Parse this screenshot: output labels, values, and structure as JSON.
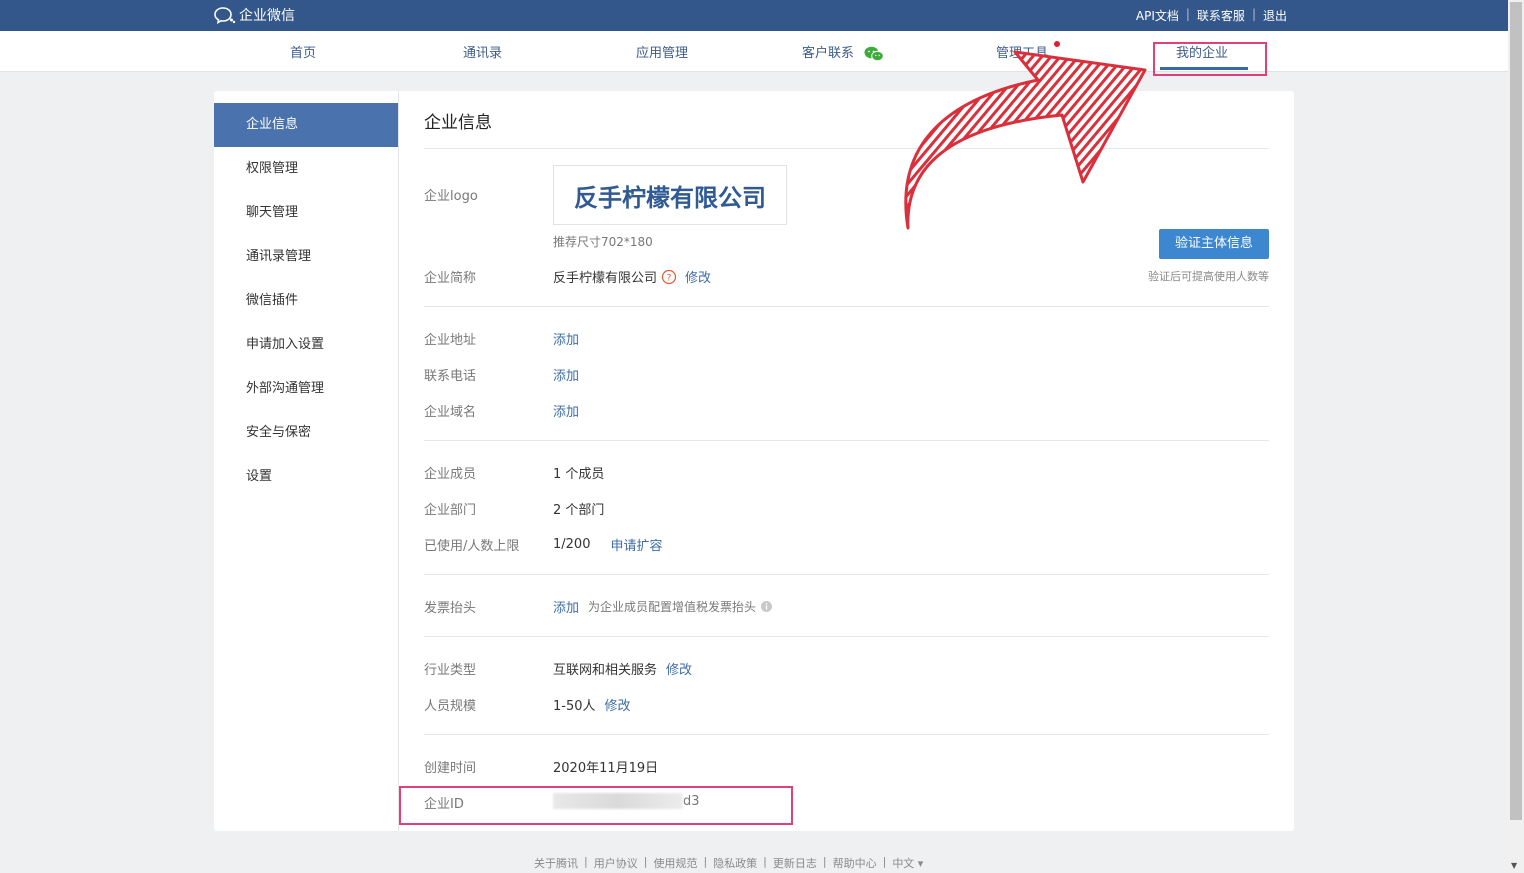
{
  "header": {
    "app_name": "企业微信",
    "links": [
      "API文档",
      "联系客服",
      "退出"
    ]
  },
  "nav": {
    "items": [
      "首页",
      "通讯录",
      "应用管理",
      "客户联系",
      "管理工具",
      "我的企业"
    ],
    "active": "我的企业"
  },
  "sidebar": {
    "items": [
      "企业信息",
      "权限管理",
      "聊天管理",
      "通讯录管理",
      "微信插件",
      "申请加入设置",
      "外部沟通管理",
      "安全与保密",
      "设置"
    ],
    "active": "企业信息"
  },
  "main": {
    "title": "企业信息",
    "logo_label": "企业logo",
    "logo_text": "反手柠檬有限公司",
    "logo_hint": "推荐尺寸702*180",
    "verify_button": "验证主体信息",
    "verify_hint": "验证后可提高使用人数等",
    "short_name_label": "企业简称",
    "short_name": "反手柠檬有限公司",
    "edit": "修改",
    "address_label": "企业地址",
    "phone_label": "联系电话",
    "domain_label": "企业域名",
    "add": "添加",
    "members_label": "企业成员",
    "members_value": "1 个成员",
    "departments_label": "企业部门",
    "departments_value": "2 个部门",
    "quota_label": "已使用/人数上限",
    "quota_value": "1/200",
    "expand_link": "申请扩容",
    "invoice_label": "发票抬头",
    "invoice_desc": "为企业成员配置增值税发票抬头",
    "industry_label": "行业类型",
    "industry_value": "互联网和相关服务",
    "scale_label": "人员规模",
    "scale_value": "1-50人",
    "created_label": "创建时间",
    "created_value": "2020年11月19日",
    "corp_id_label": "企业ID",
    "corp_id_suffix": "d3"
  },
  "footer": {
    "links": [
      "关于腾讯",
      "用户协议",
      "使用规范",
      "隐私政策",
      "更新日志",
      "帮助中心",
      "中文 ▾"
    ]
  },
  "colors": {
    "topbar": "#33578a",
    "accent": "#4a73ad",
    "link": "#3d6ca8",
    "highlight": "#e0407c",
    "arrow": "#d9303b"
  }
}
